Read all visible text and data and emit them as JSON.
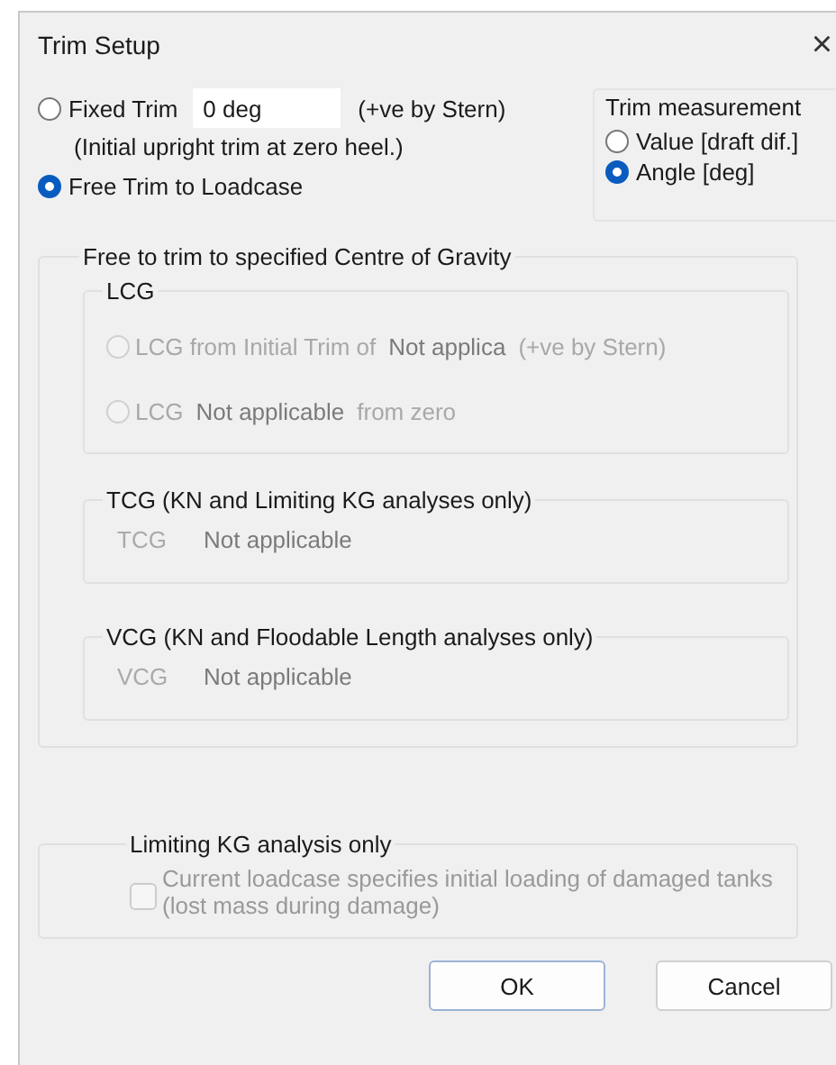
{
  "window": {
    "title": "Trim Setup",
    "close": "×"
  },
  "trim_mode": [
    {
      "kind": "fixed",
      "label": "Fixed Trim",
      "selected": false,
      "value": "0 deg",
      "suffix": "(+ve by Stern)",
      "note": "(Initial upright trim at zero heel.)"
    },
    {
      "kind": "free",
      "label": "Free Trim to Loadcase",
      "selected": true
    }
  ],
  "trim_measurement": {
    "title": "Trim measurement",
    "options": [
      {
        "label": "Value [draft dif.]",
        "selected": false
      },
      {
        "label": "Angle [deg]",
        "selected": true
      }
    ]
  },
  "cg_group": {
    "title": "Free to trim to specified Centre of Gravity",
    "lcg": {
      "title": "LCG",
      "disabled": true,
      "options": [
        {
          "label": "LCG from Initial Trim of",
          "value": "Not applica",
          "suffix": "(+ve by Stern)",
          "selected": false
        },
        {
          "label": "LCG",
          "value": "Not applicable",
          "suffix": "from zero",
          "selected": false
        }
      ]
    },
    "axes": [
      {
        "title": "TCG (KN and Limiting KG analyses only)",
        "label": "TCG",
        "value": "Not applicable",
        "disabled": true
      },
      {
        "title": "VCG (KN and Floodable Length analyses only)",
        "label": "VCG",
        "value": "Not applicable",
        "disabled": true
      }
    ]
  },
  "limiting_kg": {
    "title": "Limiting KG analysis only",
    "checkbox": {
      "label": "Current loadcase specifies initial loading of damaged tanks (lost mass during damage)",
      "checked": false,
      "disabled": true
    }
  },
  "buttons": [
    {
      "label": "OK",
      "default": true
    },
    {
      "label": "Cancel",
      "default": false
    }
  ]
}
